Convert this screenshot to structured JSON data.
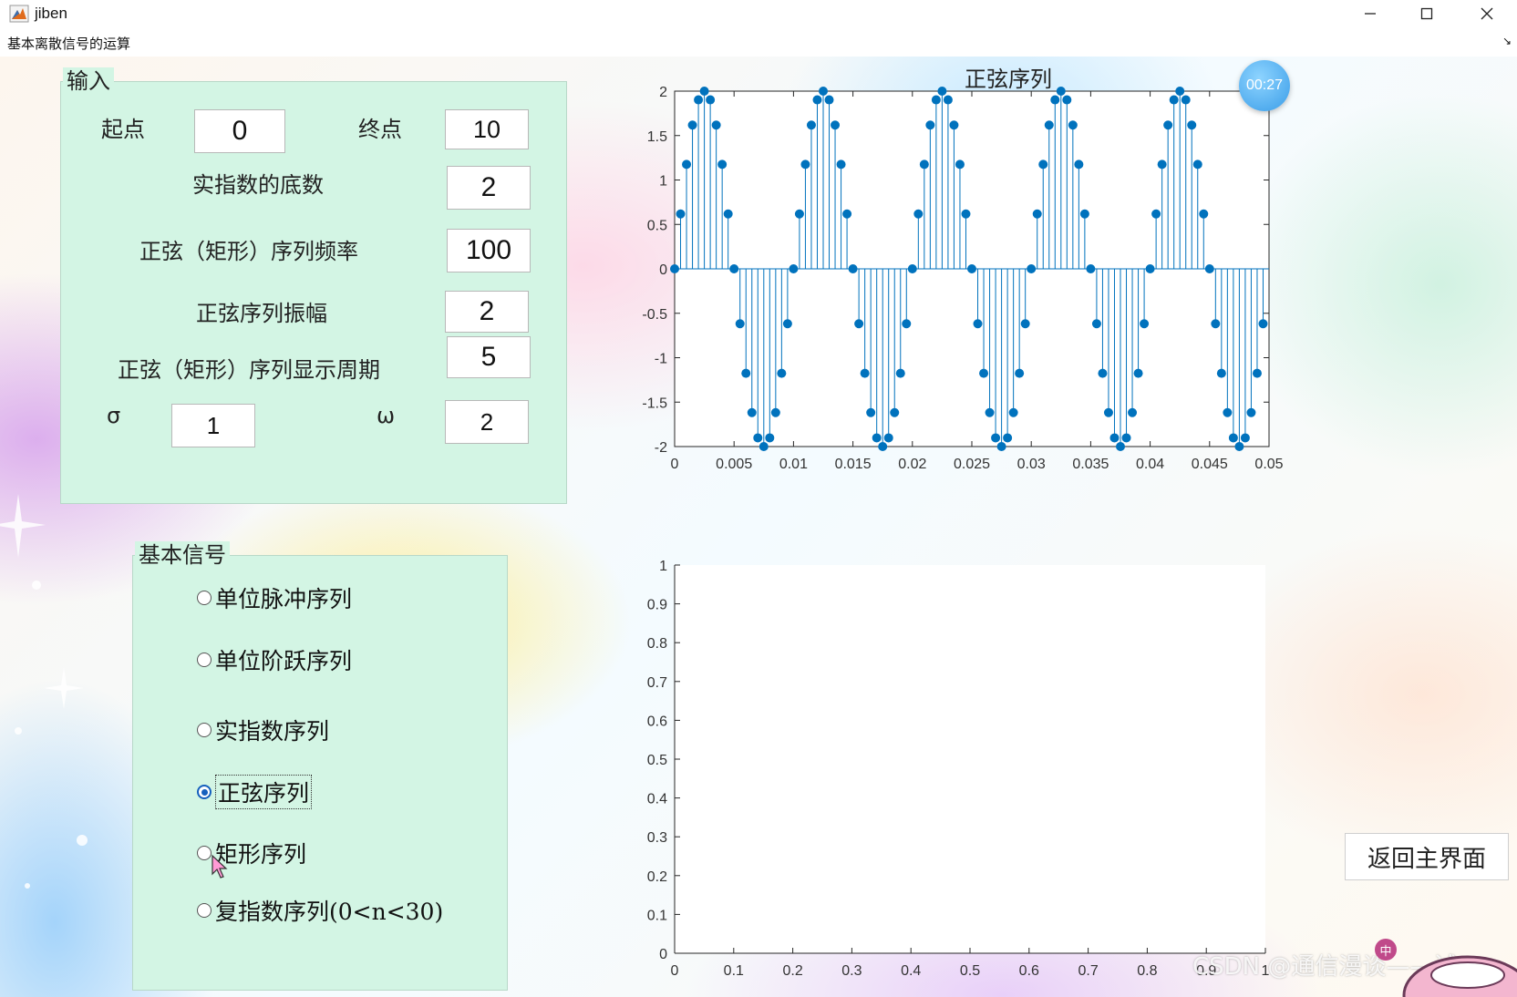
{
  "window": {
    "title": "jiben"
  },
  "menu": {
    "title": "基本离散信号的运算",
    "corner_glyph": "↘"
  },
  "input_panel": {
    "caption": "输入",
    "start_label": "起点",
    "start_value": "0",
    "end_label": "终点",
    "end_value": "10",
    "base_label": "实指数的底数",
    "base_value": "2",
    "freq_label": "正弦（矩形）序列频率",
    "freq_value": "100",
    "amp_label": "正弦序列振幅",
    "amp_value": "2",
    "period_label": "正弦（矩形）序列显示周期",
    "period_value": "5",
    "sigma_label": "σ",
    "sigma_value": "1",
    "omega_label": "ω",
    "omega_value": "2"
  },
  "signal_panel": {
    "caption": "基本信号",
    "options": [
      {
        "label": "单位脉冲序列",
        "selected": false
      },
      {
        "label": "单位阶跃序列",
        "selected": false
      },
      {
        "label": "实指数序列",
        "selected": false
      },
      {
        "label": "正弦序列",
        "selected": true
      },
      {
        "label": "矩形序列",
        "selected": false
      },
      {
        "label": "复指数序列(0<n<30)",
        "selected": false
      }
    ]
  },
  "return_button": {
    "label": "返回主界面"
  },
  "timer": {
    "text": "00:27"
  },
  "watermark": {
    "text": "CSDN @通信漫谈——试"
  },
  "colors": {
    "stem": "#0072bd",
    "panel": "#d3f5e4"
  },
  "chart_data": [
    {
      "type": "stem",
      "title": "正弦序列",
      "xlim": [
        0,
        0.05
      ],
      "ylim": [
        -2,
        2
      ],
      "xticks": [
        "0",
        "0.005",
        "0.01",
        "0.015",
        "0.02",
        "0.025",
        "0.03",
        "0.035",
        "0.04",
        "0.045",
        "0.05"
      ],
      "yticks": [
        "2",
        "1.5",
        "1",
        "0.5",
        "0",
        "-0.5",
        "-1",
        "-1.5",
        "-2"
      ],
      "series": [
        {
          "function": "y = 2*sin(2*pi*100*t)",
          "amplitude": 2,
          "frequency_hz": 100,
          "t_start": 0,
          "t_step": 0.0005,
          "point_count": 100
        }
      ]
    },
    {
      "type": "empty-axes",
      "title": "",
      "xlim": [
        0,
        1
      ],
      "ylim": [
        0,
        1
      ],
      "xticks": [
        "0",
        "0.1",
        "0.2",
        "0.3",
        "0.4",
        "0.5",
        "0.6",
        "0.7",
        "0.8",
        "0.9",
        "1"
      ],
      "yticks": [
        "1",
        "0.9",
        "0.8",
        "0.7",
        "0.6",
        "0.5",
        "0.4",
        "0.3",
        "0.2",
        "0.1",
        "0"
      ],
      "series": []
    }
  ]
}
